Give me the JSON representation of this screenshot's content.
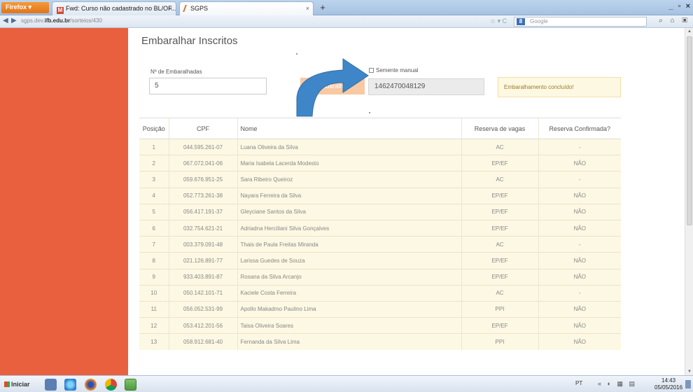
{
  "browser": {
    "menu_button": "Firefox ▾",
    "tabs": [
      {
        "label": "Fwd: Curso não cadastrado no BL/OF...",
        "close": "×"
      },
      {
        "label": "SGPS",
        "close": "×"
      }
    ],
    "new_tab": "+",
    "window_controls": "_ ▫ ×",
    "url_prefix": "sgps.dev.",
    "url_domain": "ifb.edu.br",
    "url_path": "/sorteios/430",
    "address_icons": "☆ ▾ C",
    "search_placeholder": "Google",
    "search_logo": "8",
    "nav_right_icons": "⌕ ⌂ ▣"
  },
  "page": {
    "title": "Embaralhar Inscritos",
    "num_label": "Nº de Embaralhadas",
    "num_value": "5",
    "shuffle_button": "Embaralhar",
    "manual_seed_label": "Semente manual",
    "seed_value": "1462470048129",
    "alert_text": "Embaralhamento concluído!"
  },
  "table": {
    "headers": [
      "Posição",
      "CPF",
      "Nome",
      "Reserva de vagas",
      "Reserva Confirmada?"
    ],
    "rows": [
      [
        "1",
        "044.595.261-07",
        "Luana Oliveira da Silva",
        "AC",
        "-"
      ],
      [
        "2",
        "067.072.041-06",
        "Maria Isabela Lacerda Modesto",
        "EP/EF",
        "NÃO"
      ],
      [
        "3",
        "059.676.951-25",
        "Sara Ribeiro Queiroz",
        "AC",
        "-"
      ],
      [
        "4",
        "052.773.261-38",
        "Nayara Ferreira da Silva",
        "EP/EF",
        "NÃO"
      ],
      [
        "5",
        "056.417.191-37",
        "Gleyciane Santos da Silva",
        "EP/EF",
        "NÃO"
      ],
      [
        "6",
        "032.754.621-21",
        "Adriadna Herciliani Silva Gonçalves",
        "EP/EF",
        "NÃO"
      ],
      [
        "7",
        "003.379.091-48",
        "Thais de Paula Freitas Miranda",
        "AC",
        "-"
      ],
      [
        "8",
        "021.126.891-77",
        "Larissa Guedes de Souza",
        "EP/EF",
        "NÃO"
      ],
      [
        "9",
        "933.403.891-87",
        "Rosana da Silva Arcanjo",
        "EP/EF",
        "NÃO"
      ],
      [
        "10",
        "050.142.101-71",
        "Kaciele Costa Ferreira",
        "AC",
        "-"
      ],
      [
        "11",
        "056.052.531-99",
        "Apollo Makadmo Paulino Lima",
        "PPI",
        "NÃO"
      ],
      [
        "12",
        "053.412.201-56",
        "Taisa Oliveira Soares",
        "EP/EF",
        "NÃO"
      ],
      [
        "13",
        "058.912.681-40",
        "Fernanda da Silva Lima",
        "PPI",
        "NÃO"
      ]
    ]
  },
  "taskbar": {
    "start_label": "Iniciar",
    "lang": "PT",
    "tray_icons": "« ◐ ▦ ▤",
    "time": "14:43",
    "date": "05/05/2016"
  },
  "colors": {
    "sidebar": "#e9603f",
    "row_bg": "#fcf8e3",
    "button": "#f8c9a3",
    "arrow": "#3f86c8"
  }
}
